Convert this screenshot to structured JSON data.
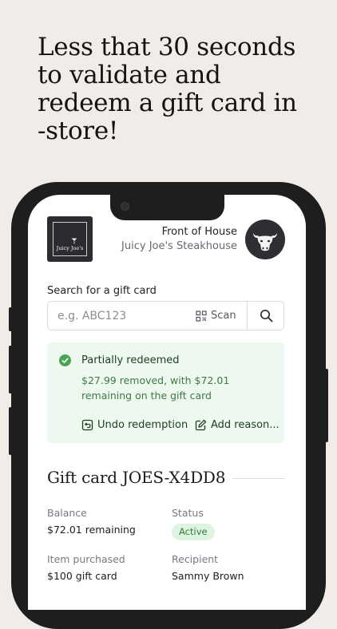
{
  "headline": "Less that 30 seconds\nto validate and\nredeem a gift card in\n-store!",
  "header": {
    "logo_text": "Juicy Joe's",
    "title": "Front of House",
    "subtitle": "Juicy Joe's Steakhouse",
    "avatar_icon": "bull-icon"
  },
  "search": {
    "label": "Search for a gift card",
    "placeholder": "e.g. ABC123",
    "value": "",
    "scan_label": "Scan"
  },
  "alert": {
    "title": "Partially redeemed",
    "body": "$27.99 removed, with $72.01 remaining on the gift card",
    "undo_label": "Undo redemption",
    "add_reason_label": "Add reason..."
  },
  "gift_card": {
    "title": "Gift card JOES-X4DD8",
    "balance_label": "Balance",
    "balance_value": "$72.01 remaining",
    "status_label": "Status",
    "status_value": "Active",
    "item_label": "Item purchased",
    "item_value": "$100 gift card",
    "recipient_label": "Recipient",
    "recipient_value": "Sammy Brown"
  },
  "colors": {
    "background": "#f1ece8",
    "phone": "#1e1e1e",
    "success_bg": "#edf8ee",
    "success_icon": "#49a553",
    "success_text": "#3f7a45"
  }
}
